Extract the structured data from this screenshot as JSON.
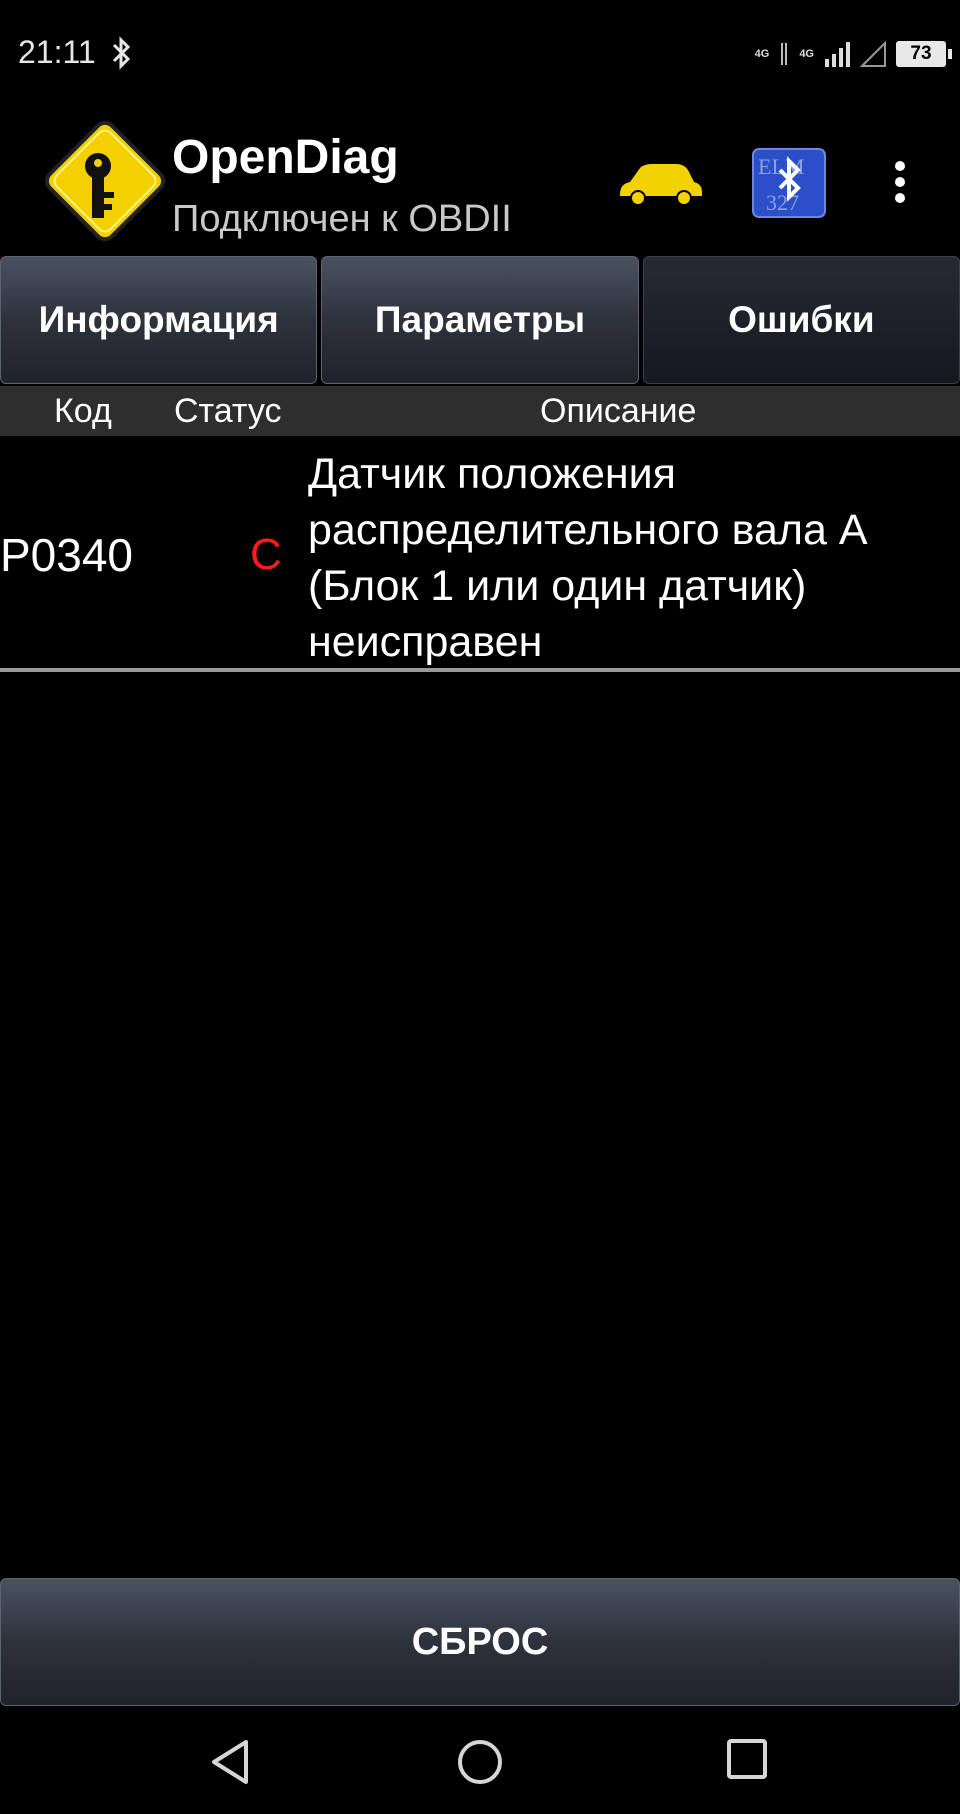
{
  "status_bar": {
    "time": "21:11",
    "network_1": "4G",
    "network_2": "4G",
    "battery": "73",
    "icons": [
      "bluetooth-icon",
      "signal-icon",
      "signal-empty-icon",
      "battery-icon"
    ]
  },
  "app_bar": {
    "title": "OpenDiag",
    "subtitle": "Подключен к OBDII",
    "icons": [
      "app-logo-icon",
      "car-icon",
      "elm327-bluetooth-icon",
      "overflow-menu-icon"
    ]
  },
  "tabs": [
    {
      "label": "Информация",
      "active": false
    },
    {
      "label": "Параметры",
      "active": false
    },
    {
      "label": "Ошибки",
      "active": true
    }
  ],
  "table": {
    "headers": {
      "code": "Код",
      "status": "Статус",
      "description": "Описание"
    },
    "rows": [
      {
        "code": "P0340",
        "status": "C",
        "description": "Датчик положения распределительного вала А (Блок 1 или один датчик) неисправен"
      }
    ]
  },
  "reset_button": "СБРОС",
  "nav_bar": {
    "icons": [
      "back-icon",
      "home-icon",
      "recents-icon"
    ]
  },
  "colors": {
    "background": "#000000",
    "status_error": "#ff1a1a",
    "logo_yellow": "#f5d000",
    "car_yellow": "#f2d200",
    "elm_blue": "#2b4fc9"
  }
}
